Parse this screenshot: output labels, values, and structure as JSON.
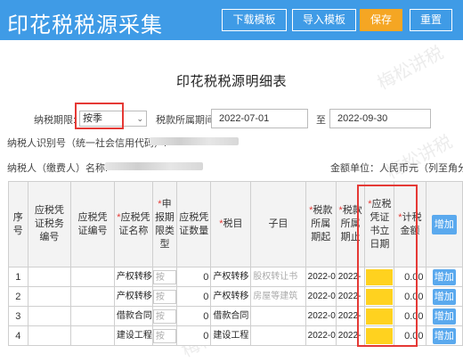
{
  "header": {
    "title": "印花税税源采集",
    "buttons": [
      "下载模板",
      "导入模板",
      "保存",
      "重置"
    ]
  },
  "form": {
    "title": "印花税税源明细表",
    "period_label": "纳税期限:",
    "period_value": "按季",
    "range_label": "税款所属期间:",
    "start_date": "2022-07-01",
    "range_sep": "至",
    "end_date": "2022-09-30",
    "taxpayer_id_label": "纳税人识别号（统一社会信用代码）:",
    "taxpayer_name_label": "纳税人（缴费人）名称:",
    "currency": "金额单位：人民币元（列至角分）"
  },
  "table": {
    "headers": {
      "seq": "序号",
      "voucher_tax_no": "应税凭证税务编号",
      "voucher_no": "应税凭证编号",
      "voucher_name": "应税凭证名称",
      "period_type": "申报期限类型",
      "voucher_qty": "应税凭证数量",
      "tax_item": "税目",
      "sub_item": "子目",
      "period_start": "税款所属期起",
      "period_end": "税款所属期止",
      "voucher_date": "应税凭证书立日期",
      "tax_amount": "计税金额",
      "add": "增加"
    },
    "rows": [
      {
        "seq": "1",
        "name": "产权转移",
        "ptype": "按",
        "qty": "0",
        "item": "产权转移",
        "sub": "股权转让书",
        "start": "2022-0",
        "end": "2022-",
        "amount": "0.00",
        "add": "增加"
      },
      {
        "seq": "2",
        "name": "产权转移",
        "ptype": "按",
        "qty": "0",
        "item": "产权转移",
        "sub": "房屋等建筑",
        "start": "2022-0",
        "end": "2022-",
        "amount": "0.00",
        "add": "增加"
      },
      {
        "seq": "3",
        "name": "借款合同",
        "ptype": "按",
        "qty": "0",
        "item": "借款合同",
        "sub": "",
        "start": "2022-0",
        "end": "2022-",
        "amount": "0.00",
        "add": "增加"
      },
      {
        "seq": "4",
        "name": "建设工程",
        "ptype": "按",
        "qty": "0",
        "item": "建设工程",
        "sub": "",
        "start": "2022-0",
        "end": "2022-",
        "amount": "0.00",
        "add": "增加"
      }
    ]
  },
  "watermark": "梅松讲税",
  "colors": {
    "header": "#3f9be6",
    "save": "#f5a623",
    "highlight": "#e53935",
    "date_fill": "#ffd21f"
  }
}
